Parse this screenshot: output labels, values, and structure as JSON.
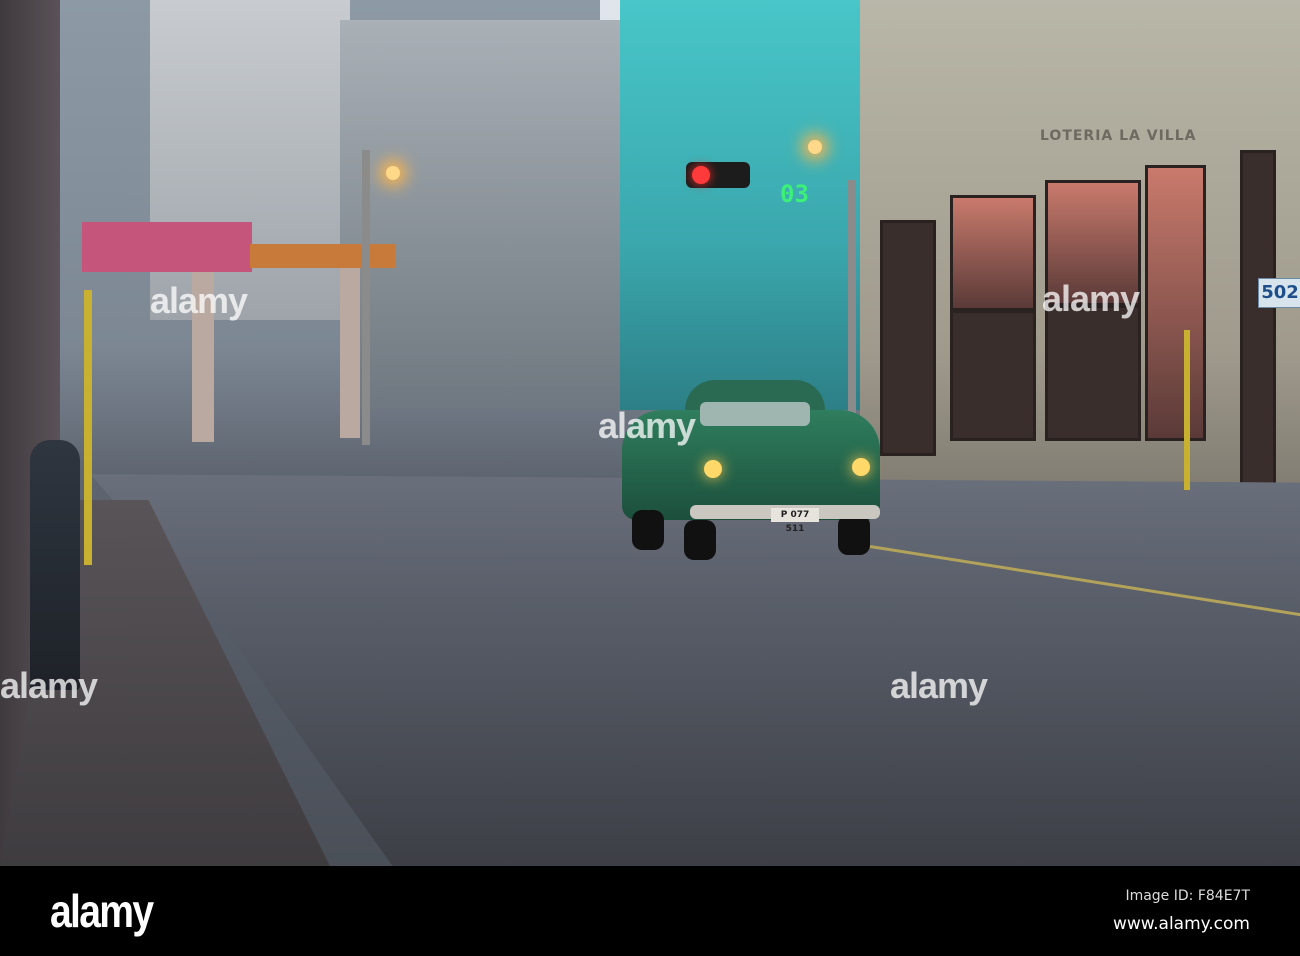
{
  "scene": {
    "traffic_counter": "03",
    "license_plate": "P 077 511",
    "house_number": "502",
    "shop_sign": "LOTERIA LA VILLA"
  },
  "watermark": {
    "text": "alamy"
  },
  "footer": {
    "logo": "alamy",
    "image_id": "Image ID: F84E7T",
    "url": "www.alamy.com"
  }
}
